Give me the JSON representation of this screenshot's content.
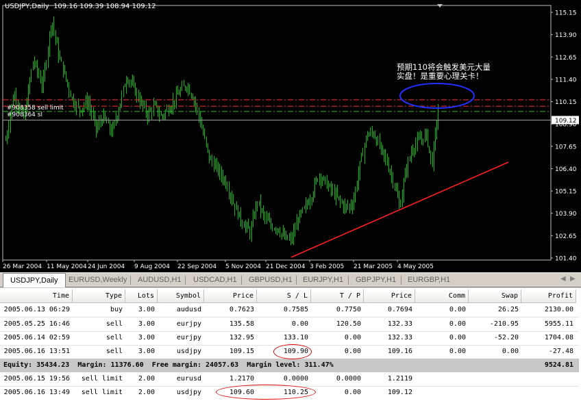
{
  "chart": {
    "title": "USDJPY,Daily  109.16 109.39 108.94 109.12",
    "price_levels": [
      "115.15",
      "113.90",
      "112.65",
      "111.40",
      "110.15",
      "108.90",
      "107.65",
      "106.40",
      "105.15",
      "103.90",
      "102.65",
      "101.40"
    ],
    "current_price": "109.12",
    "date_labels": [
      "26 Mar 2004",
      "11 May 2004",
      "24 Jun 2004",
      "9 Aug 2004",
      "22 Sep 2004",
      "5 Nov 2004",
      "21 Dec 2004",
      "3 Feb 2005",
      "21 Mar 2005",
      "4 May 2005"
    ],
    "order_lines": [
      {
        "label": "#908358 sell limit",
        "price": 110.25,
        "color": "#ff3030"
      },
      {
        "label": "#908364 sl",
        "price": 109.9,
        "color": "#ff3030"
      },
      {
        "label": "",
        "price": 109.6,
        "color": "#30c030"
      }
    ],
    "annotation_line1": "预期110将会触发美元大量",
    "annotation_line2": "实盘！是重要心理关卡！",
    "colors": {
      "candle": "#00c000",
      "trendline": "#ff2020",
      "ellipse": "#2030ff",
      "background": "#000000"
    }
  },
  "tabs": [
    "USDJPY,Daily",
    "EURUSD,Weekly",
    "AUDUSD,H1",
    "USDCAD,H1",
    "GBPUSD,H1",
    "EURJPY,H1",
    "GBPJPY,H1",
    "EURGBP,H1"
  ],
  "active_tab": "USDJPY,Daily",
  "terminal": {
    "headers": [
      "Time",
      "Type",
      "Lots",
      "Symbol",
      "Price",
      "S / L",
      "T / P",
      "Price",
      "Comm",
      "Swap",
      "Profit"
    ],
    "rows": [
      [
        "2005.06.13 06:29",
        "buy",
        "3.00",
        "audusd",
        "0.7623",
        "0.7585",
        "0.7750",
        "0.7694",
        "0.00",
        "26.25",
        "2130.00"
      ],
      [
        "2005.05.25 16:46",
        "sell",
        "3.00",
        "eurjpy",
        "135.58",
        "0.00",
        "120.50",
        "132.33",
        "0.00",
        "-210.95",
        "5955.11"
      ],
      [
        "2005.06.14 02:59",
        "sell",
        "3.00",
        "eurjpy",
        "132.95",
        "133.10",
        "0.00",
        "132.33",
        "0.00",
        "-52.20",
        "1704.08"
      ],
      [
        "2005.06.16 13:51",
        "sell",
        "3.00",
        "usdjpy",
        "109.15",
        "109.90",
        "0.00",
        "109.16",
        "0.00",
        "0.00",
        "-27.48"
      ]
    ],
    "summary_text": "Equity: 35434.23  Margin: 11376.60  Free margin: 24057.63  Margin level: 311.47%",
    "summary_profit": "9524.81",
    "pending_rows": [
      [
        "2005.06.15 19:56",
        "sell limit",
        "2.00",
        "eurusd",
        "1.2170",
        "0.0000",
        "0.0000",
        "1.2119"
      ],
      [
        "2005.06.16 13:49",
        "sell limit",
        "2.00",
        "usdjpy",
        "109.60",
        "110.25",
        "0.00",
        "109.12"
      ]
    ]
  }
}
